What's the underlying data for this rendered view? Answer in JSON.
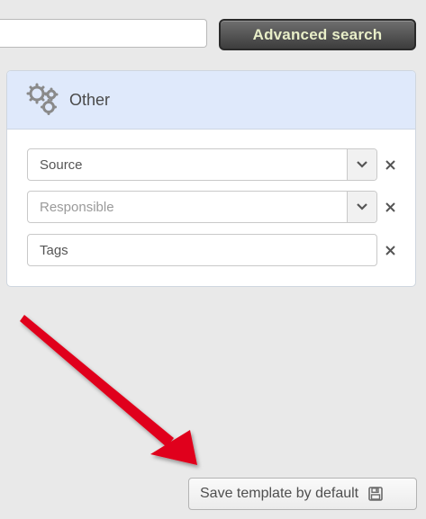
{
  "toolbar": {
    "search": {
      "value": "",
      "placeholder": ""
    },
    "advanced_search_label": "Advanced search"
  },
  "panel": {
    "title": "Other",
    "title_icon": "gears-icon",
    "fields": [
      {
        "name": "source",
        "text": "Source",
        "kind": "value",
        "has_dropdown": true
      },
      {
        "name": "responsible",
        "text": "Responsible",
        "kind": "placeholder",
        "has_dropdown": true
      },
      {
        "name": "tags",
        "text": "Tags",
        "kind": "value",
        "has_dropdown": false
      }
    ]
  },
  "footer": {
    "save_template_label": "Save template by default",
    "save_icon": "floppy-disk-icon"
  },
  "annotation": {
    "icon": "red-arrow-icon",
    "color": "#e0001a"
  }
}
